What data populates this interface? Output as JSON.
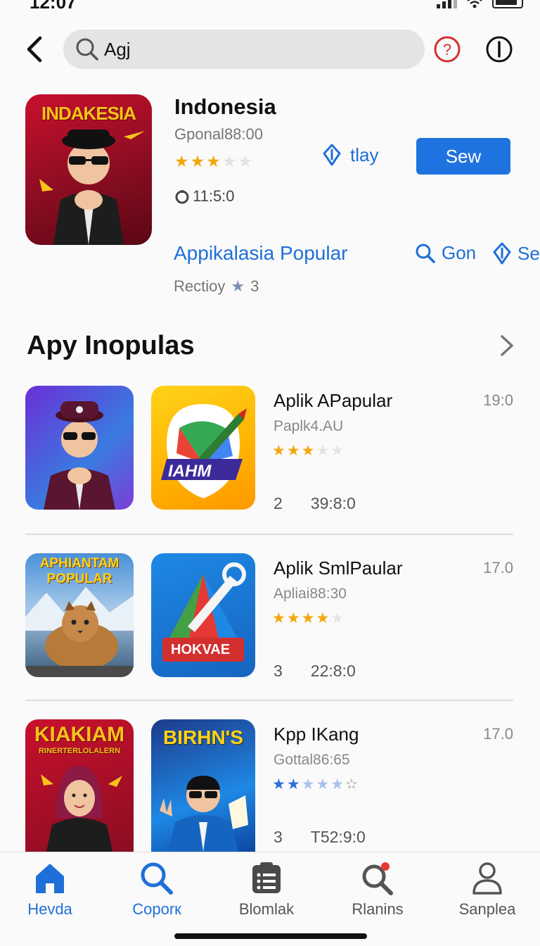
{
  "status": {
    "time": "12:07"
  },
  "search": {
    "value": "Agj"
  },
  "featured": {
    "banner": "INDAKESIA",
    "title": "Indonesia",
    "subtitle": "Gponal88:00",
    "rating_stars": 3,
    "time": "11:5:0",
    "play_label": "tlay",
    "sew_label": "Sew",
    "popular_link": "Appikalasia Popular",
    "gon_label": "Gon",
    "se_label": "Se",
    "rect_label": "Rectioy",
    "rect_badge": "3"
  },
  "section": {
    "title": "Apy Inopulas"
  },
  "apps": [
    {
      "name": "Aplik APapular",
      "subtitle": "Paplk4.AU",
      "stars": 3,
      "count": "2",
      "time": "39:8:0",
      "size": "19:0",
      "icon_b_text": "IAHM"
    },
    {
      "name": "Aplik SmlPaular",
      "subtitle": "Apliai88:30",
      "stars": 4,
      "count": "3",
      "time": "22:8:0",
      "size": "17.0",
      "icon_a_text_1": "APHIANTAM",
      "icon_a_text_2": "POPULAR",
      "icon_b_text": "HOKVAE"
    },
    {
      "name": "Kpp IKang",
      "subtitle": "Gottal86:65",
      "stars": 2,
      "count": "3",
      "time": "T52:9:0",
      "size": "17.0",
      "icon_a_text_1": "KIAKIAM",
      "icon_a_text_2": "RINERTERLOLALERN",
      "icon_b_text": "BIRHN'S"
    }
  ],
  "nav": [
    {
      "label": "Hevda",
      "icon": "home-icon",
      "active": true
    },
    {
      "label": "Coporк",
      "icon": "search-icon",
      "active": true
    },
    {
      "label": "Blomlak",
      "icon": "list-icon",
      "active": false
    },
    {
      "label": "Rlanins",
      "icon": "search-badge-icon",
      "active": false
    },
    {
      "label": "Sanplea",
      "icon": "person-icon",
      "active": false
    }
  ],
  "colors": {
    "accent": "#1f6fd8",
    "star": "#f4a60c",
    "primary_button": "#1f73e0"
  }
}
